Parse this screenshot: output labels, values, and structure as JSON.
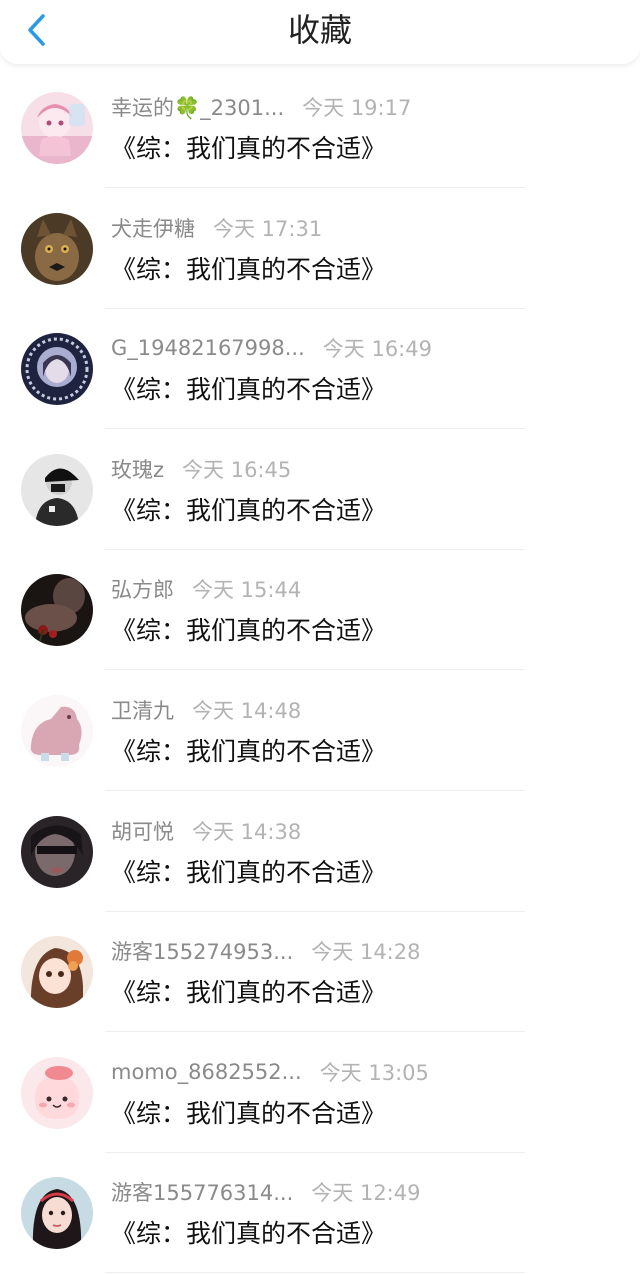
{
  "header": {
    "title": "收藏"
  },
  "items": [
    {
      "name_prefix": "幸运的",
      "clover": "🍀",
      "name_suffix": "_2301...",
      "time": "今天 19:17",
      "title": "《综：我们真的不合适》",
      "avatar": "pink-anime-girl"
    },
    {
      "name": "犬走伊糖",
      "time": "今天 17:31",
      "title": "《综：我们真的不合适》",
      "avatar": "kitten"
    },
    {
      "name": "G_19482167998...",
      "time": "今天 16:49",
      "title": "《综：我们真的不合适》",
      "avatar": "girl-dark-circle"
    },
    {
      "name": "玫瑰z",
      "time": "今天 16:45",
      "title": "《综：我们真的不合适》",
      "avatar": "cap-person"
    },
    {
      "name": "弘方郎",
      "time": "今天 15:44",
      "title": "《综：我们真的不合适》",
      "avatar": "dark-roses"
    },
    {
      "name": "卫清九",
      "time": "今天 14:48",
      "title": "《综：我们真的不合适》",
      "avatar": "pink-dinosaur"
    },
    {
      "name": "胡可悦",
      "time": "今天 14:38",
      "title": "《综：我们真的不合适》",
      "avatar": "dark-portrait"
    },
    {
      "name": "游客155274953...",
      "time": "今天 14:28",
      "title": "《综：我们真的不合适》",
      "avatar": "anime-girl-brown"
    },
    {
      "name": "momo_8682552...",
      "time": "今天 13:05",
      "title": "《综：我们真的不合适》",
      "avatar": "pink-blob"
    },
    {
      "name": "游客155776314...",
      "time": "今天 12:49",
      "title": "《综：我们真的不合适》",
      "avatar": "girl-headband"
    }
  ],
  "colors": {
    "accent": "#2a9ae8",
    "primary_text": "#111111",
    "secondary_text": "#8a8a8a",
    "time_text": "#b3b3b3"
  }
}
